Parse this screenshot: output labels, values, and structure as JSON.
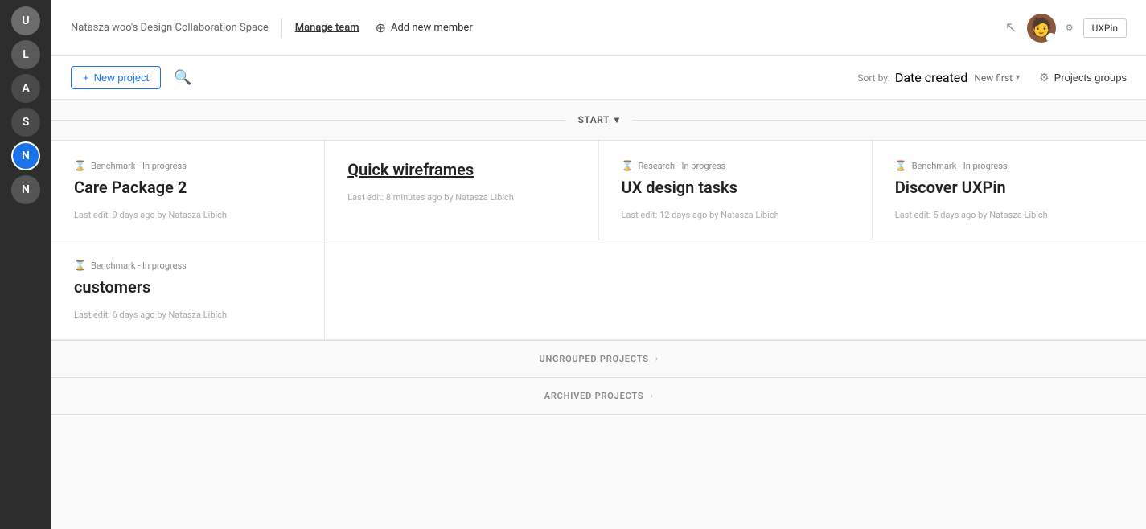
{
  "sidebar": {
    "avatars": [
      {
        "label": "U",
        "bg": "#6c6c6c",
        "active": false
      },
      {
        "label": "L",
        "bg": "#5a5a5a",
        "active": false
      },
      {
        "label": "A",
        "bg": "#4a4a4a",
        "active": false
      },
      {
        "label": "S",
        "bg": "#4a4a4a",
        "active": false
      },
      {
        "label": "N",
        "bg": "#1a73e8",
        "active": true
      },
      {
        "label": "N",
        "bg": "#555",
        "active": false
      }
    ]
  },
  "header": {
    "workspace_title": "Natasza woo's Design Collaboration Space",
    "manage_team": "Manage team",
    "add_new_member": "Add new member",
    "uxpin_badge": "UXPin"
  },
  "toolbar": {
    "new_project_label": "New project",
    "new_project_plus": "+",
    "sort_label": "Sort by:",
    "sort_value": "Date created",
    "sort_sub": "New first",
    "projects_groups": "Projects groups"
  },
  "section_start": {
    "title": "START",
    "chevron": "▾"
  },
  "projects_row1": [
    {
      "status": "Benchmark - In progress",
      "name": "Care Package 2",
      "meta": "Last edit: 9 days ago by Natasza Libich",
      "linked": false
    },
    {
      "status": "",
      "name": "Quick wireframes",
      "meta": "Last edit: 8 minutes ago by Natasza Libich",
      "linked": true
    },
    {
      "status": "Research - In progress",
      "name": "UX design tasks",
      "meta": "Last edit: 12 days ago by Natasza Libich",
      "linked": false
    },
    {
      "status": "Benchmark - In progress",
      "name": "Discover UXPin",
      "meta": "Last edit: 5 days ago by Natasza Libich",
      "linked": false
    }
  ],
  "projects_row2": [
    {
      "status": "Benchmark - In progress",
      "name": "customers",
      "meta": "Last edit: 6 days ago by Natasza Libich",
      "linked": false
    }
  ],
  "bottom": {
    "ungrouped": "UNGROUPED PROJECTS",
    "archived": "ARCHIVED PROJECTS"
  }
}
